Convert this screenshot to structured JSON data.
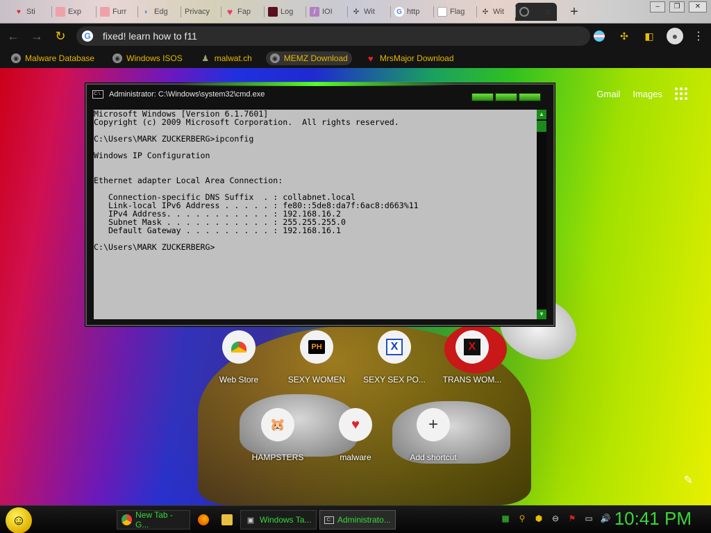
{
  "tabs": [
    {
      "label": "Sti",
      "fav": "heart-icon"
    },
    {
      "label": "Exp",
      "fav": "image-icon"
    },
    {
      "label": "Furr",
      "fav": "image-icon"
    },
    {
      "label": "Edg",
      "fav": "edge-icon"
    },
    {
      "label": "Privacy",
      "fav": ""
    },
    {
      "label": "Fap",
      "fav": "heart-icon"
    },
    {
      "label": "Log",
      "fav": "image-icon"
    },
    {
      "label": "IOI",
      "fav": "feather-icon"
    },
    {
      "label": "Wit",
      "fav": "puzzle-icon"
    },
    {
      "label": "http",
      "fav": "google-icon"
    },
    {
      "label": "Flag",
      "fav": "blank-icon"
    },
    {
      "label": "Wit",
      "fav": "puzzle-icon"
    }
  ],
  "active_tab_fav": "chrome-icon",
  "toolbar": {
    "url": "fixed! learn how to f11"
  },
  "bookmarks": [
    {
      "label": "Malware Database",
      "icon": "globe-icon"
    },
    {
      "label": "Windows ISOS",
      "icon": "globe-icon"
    },
    {
      "label": "malwat.ch",
      "icon": "person-icon"
    },
    {
      "label": "MEMZ Download",
      "icon": "globe-icon"
    },
    {
      "label": "MrsMajor Download",
      "icon": "heart-icon"
    }
  ],
  "ntp": {
    "gmail": "Gmail",
    "images": "Images"
  },
  "shortcuts": [
    {
      "label": "Web Store"
    },
    {
      "label": "SEXY WOMEN",
      "glyph": "PH"
    },
    {
      "label": "SEXY SEX PO...",
      "glyph": "X"
    },
    {
      "label": "TRANS WOM...",
      "glyph": "X"
    },
    {
      "label": "HAMPSTERS"
    },
    {
      "label": "malware"
    },
    {
      "label": "Add shortcut"
    }
  ],
  "cmd": {
    "title": "Administrator: C:\\Windows\\system32\\cmd.exe",
    "icon_text": "C:\\.",
    "lines": [
      "Microsoft Windows [Version 6.1.7601]",
      "Copyright (c) 2009 Microsoft Corporation.  All rights reserved.",
      "",
      "C:\\Users\\MARK ZUCKERBERG>ipconfig",
      "",
      "Windows IP Configuration",
      "",
      "",
      "Ethernet adapter Local Area Connection:",
      "",
      "   Connection-specific DNS Suffix  . : collabnet.local",
      "   Link-local IPv6 Address . . . . . : fe80::5de8:da7f:6ac8:d663%11",
      "   IPv4 Address. . . . . . . . . . . : 192.168.16.2",
      "   Subnet Mask . . . . . . . . . . . : 255.255.255.0",
      "   Default Gateway . . . . . . . . . : 192.168.16.1",
      "",
      "C:\\Users\\MARK ZUCKERBERG>"
    ]
  },
  "taskbar": {
    "items": [
      {
        "label": "New Tab - G...",
        "icon": "chrome-icon"
      },
      {
        "label": "",
        "icon": "firefox-icon"
      },
      {
        "label": "",
        "icon": "folder-icon"
      },
      {
        "label": "Windows Ta...",
        "icon": "task-manager-icon"
      },
      {
        "label": "Administrato...",
        "icon": "cmd-icon"
      }
    ],
    "clock": "10:41 PM"
  },
  "colors": {
    "accent": "#e8c000",
    "taskbar_text": "#38d838"
  }
}
